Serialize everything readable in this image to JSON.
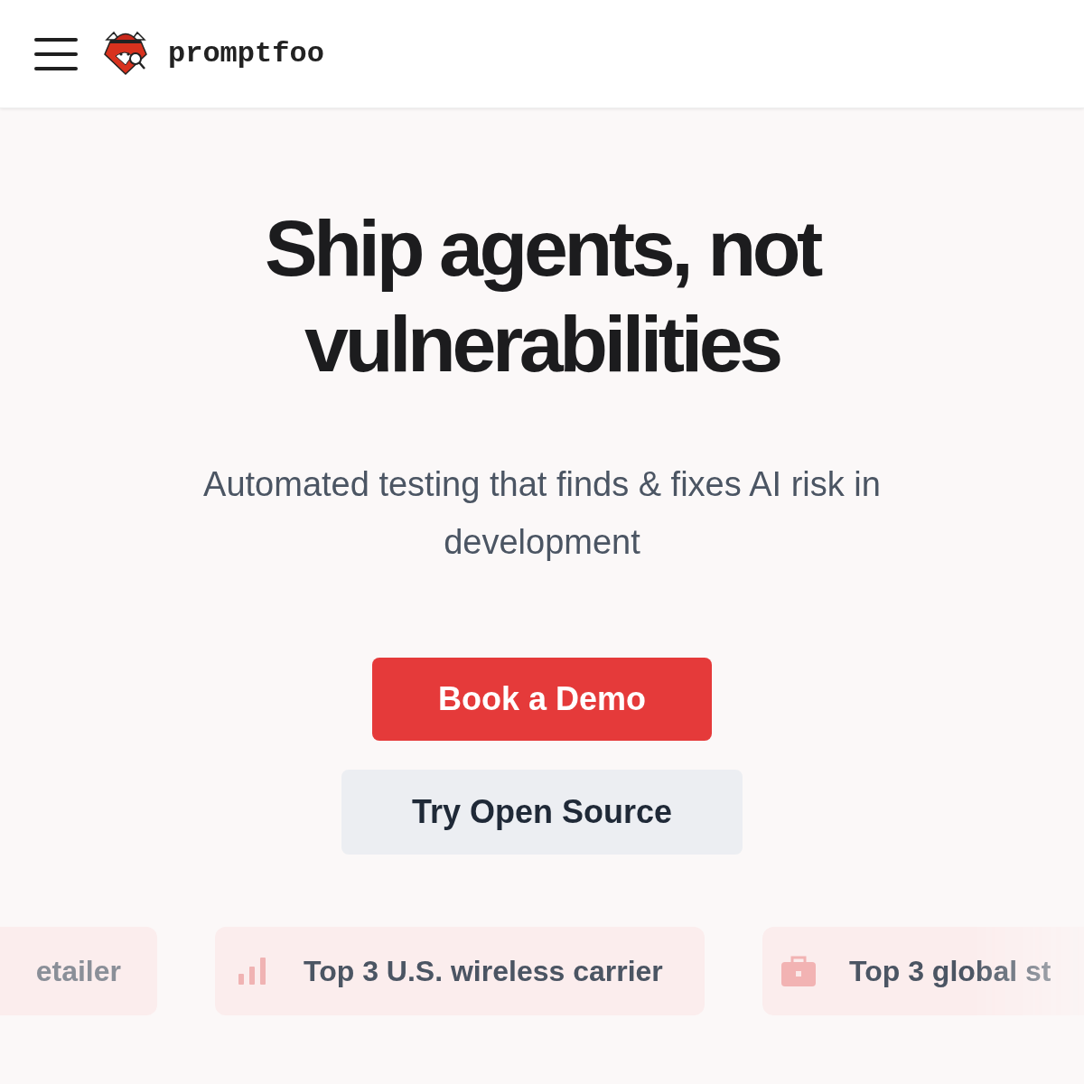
{
  "header": {
    "brand": "promptfoo"
  },
  "hero": {
    "title_lines": [
      "Ship agents, not",
      "vulnerabilities"
    ],
    "subtitle": "Automated testing that finds & fixes AI risk in development"
  },
  "buttons": [
    {
      "label": "Book a Demo",
      "kind": "primary"
    },
    {
      "label": "Try Open Source",
      "kind": "secondary"
    }
  ],
  "chips": [
    {
      "label": "etailer",
      "kind": "plain"
    },
    {
      "label": "Top 3 U.S. wireless carrier",
      "kind": "chart"
    },
    {
      "label": "Top 3 global st",
      "kind": "business"
    }
  ]
}
